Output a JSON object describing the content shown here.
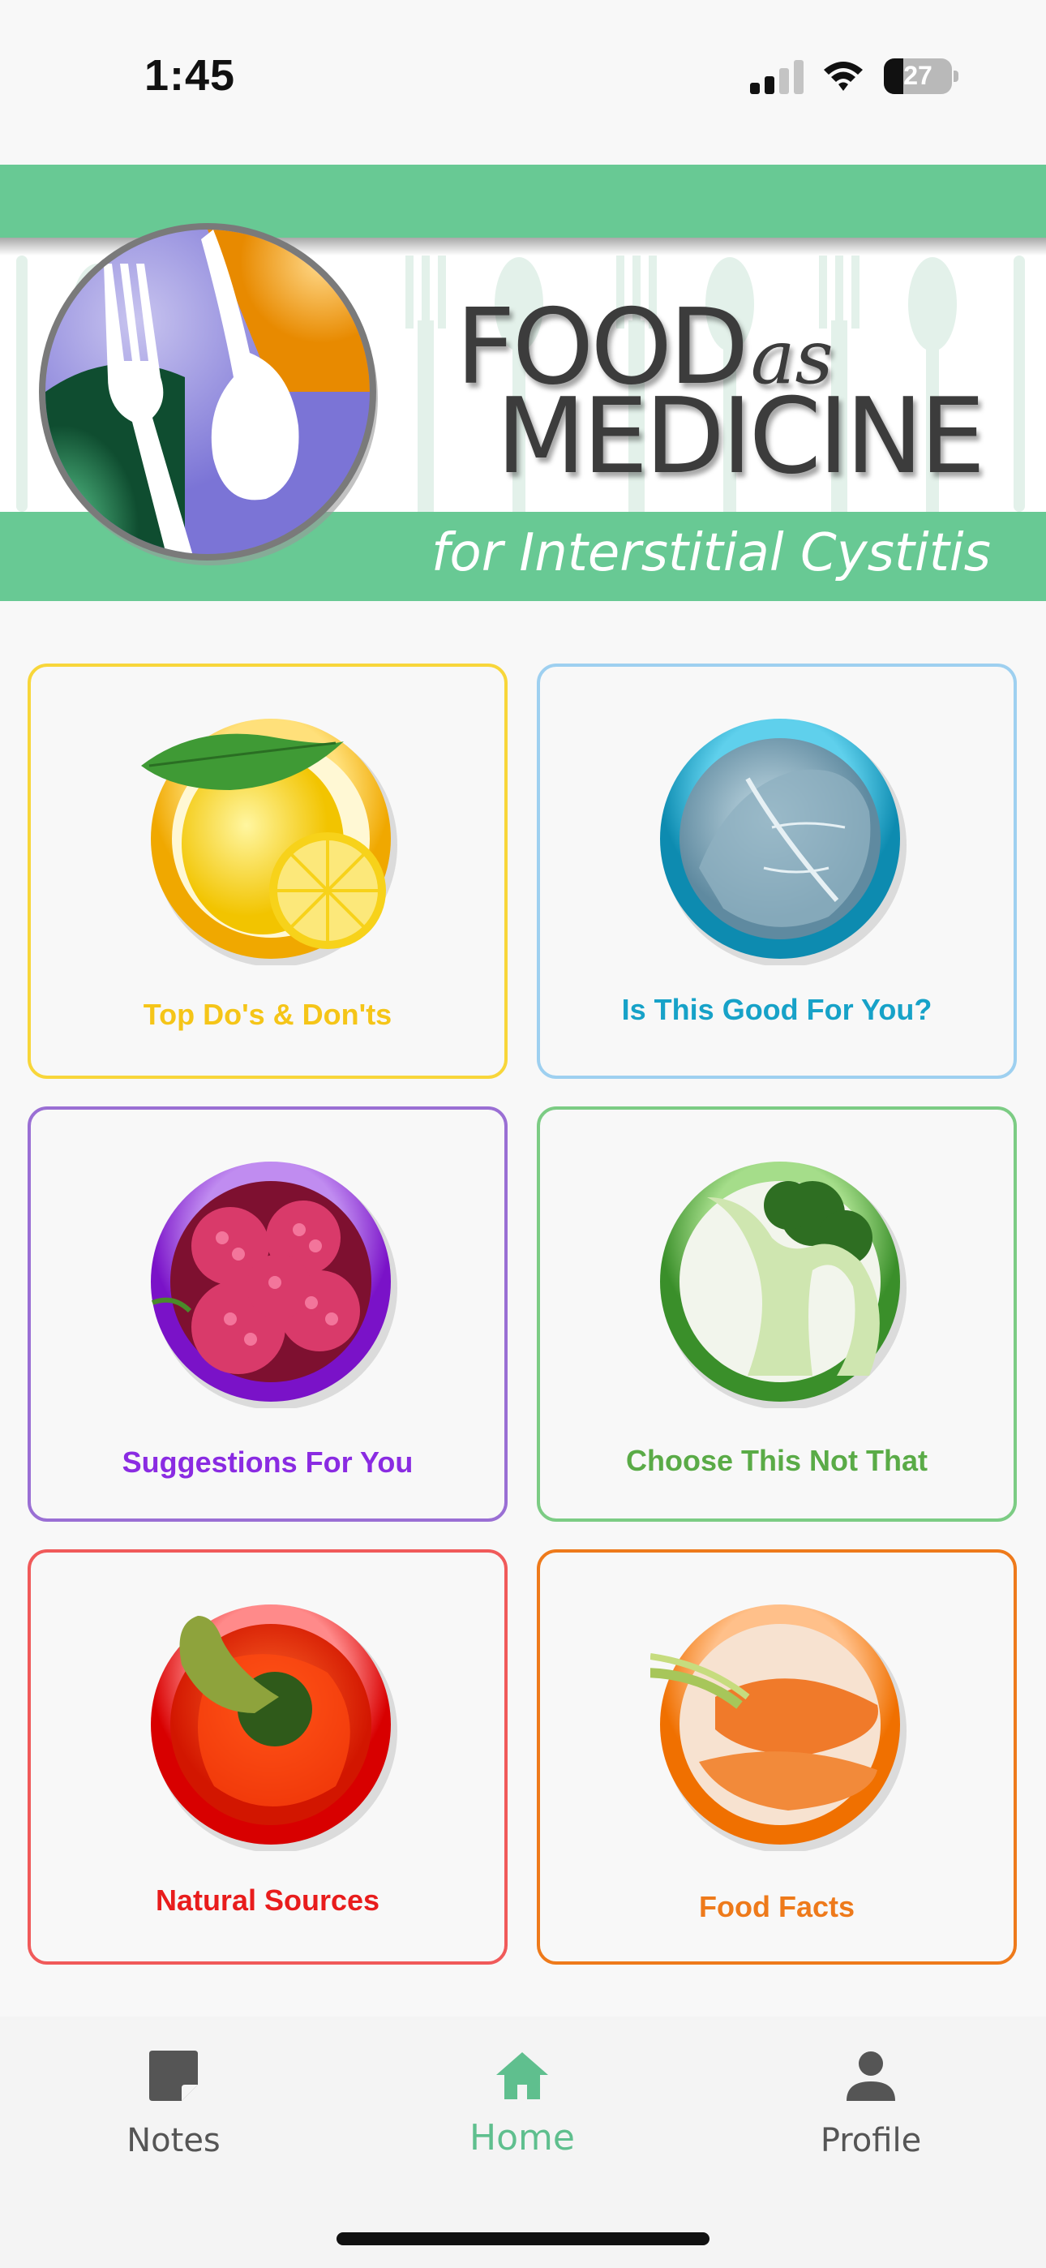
{
  "status_bar": {
    "time": "1:45",
    "battery": "27",
    "icons": [
      "cellular-signal-icon",
      "wifi-icon",
      "battery-icon"
    ]
  },
  "banner": {
    "title_line1": "FOOD",
    "title_as": "as",
    "title_line2": "MEDICINE",
    "subtitle": "for Interstitial Cystitis",
    "brand_color": "#68c994"
  },
  "tiles": [
    {
      "label": "Top Do's & Don'ts",
      "icon": "lemon-icon",
      "color": "#f5c518",
      "border": "#f8d63a"
    },
    {
      "label": "Is This Good For You?",
      "icon": "cabbage-icon",
      "color": "#17a2c8",
      "border": "#9ed0f0"
    },
    {
      "label": "Suggestions For You",
      "icon": "raspberry-icon",
      "color": "#8a2be2",
      "border": "#9a6fd4"
    },
    {
      "label": "Choose This Not That",
      "icon": "broccoli-icon",
      "color": "#5aab47",
      "border": "#7ccc84"
    },
    {
      "label": "Natural Sources",
      "icon": "red-pepper-icon",
      "color": "#e81c1c",
      "border": "#f05a5a"
    },
    {
      "label": "Food Facts",
      "icon": "carrot-icon",
      "color": "#ee7a1b",
      "border": "#ee7a1b"
    }
  ],
  "tab_bar": {
    "active": "Home",
    "tabs": [
      {
        "label": "Notes",
        "icon": "notes-icon"
      },
      {
        "label": "Home",
        "icon": "home-icon"
      },
      {
        "label": "Profile",
        "icon": "profile-icon"
      }
    ],
    "active_color": "#5fbf8e"
  }
}
